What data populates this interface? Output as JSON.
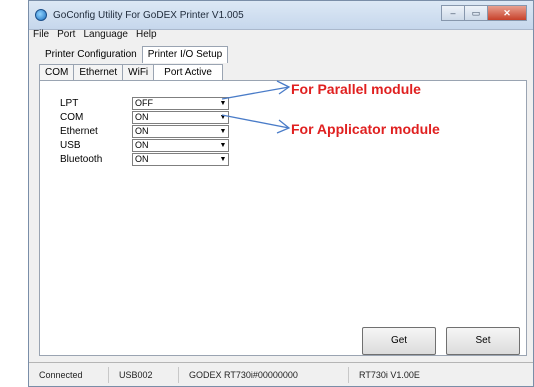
{
  "window": {
    "title": "GoConfig Utility For GoDEX Printer  V1.005",
    "controls": {
      "minimize": "–",
      "maximize": "▭",
      "close": "✕"
    }
  },
  "menu": [
    "File",
    "Port",
    "Language",
    "Help"
  ],
  "tabs": {
    "top": [
      {
        "label": "Printer Configuration",
        "active": false
      },
      {
        "label": "Printer I/O Setup",
        "active": true
      }
    ],
    "sub": [
      {
        "label": "COM",
        "active": false
      },
      {
        "label": "Ethernet",
        "active": false
      },
      {
        "label": "WiFi",
        "active": false
      },
      {
        "label": "Port Active",
        "active": true
      }
    ]
  },
  "ports": [
    {
      "label": "LPT",
      "value": "OFF"
    },
    {
      "label": "COM",
      "value": "ON"
    },
    {
      "label": "Ethernet",
      "value": "ON"
    },
    {
      "label": "USB",
      "value": "ON"
    },
    {
      "label": "Bluetooth",
      "value": "ON"
    }
  ],
  "buttons": {
    "get": "Get",
    "set": "Set"
  },
  "status": [
    "Connected",
    "USB002",
    "GODEX RT730i#00000000",
    "RT730i V1.00E"
  ],
  "annotations": {
    "parallel": "For Parallel module",
    "applicator": "For Applicator module",
    "color": "#e02020"
  }
}
